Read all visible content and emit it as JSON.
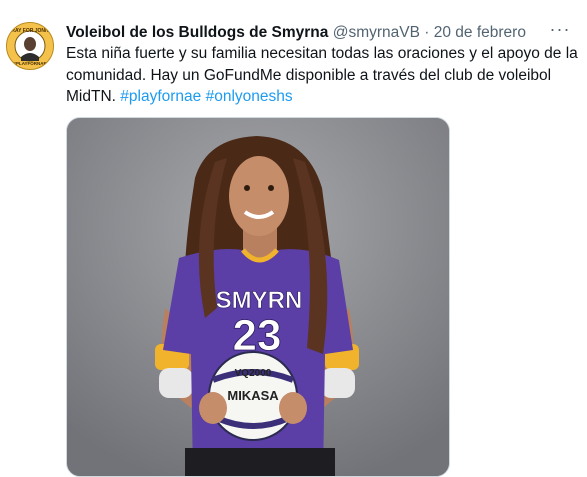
{
  "tweet": {
    "author_name": "Voleibol de los Bulldogs de Smyrna",
    "handle": "@smyrnaVB",
    "separator": "·",
    "date": "20 de febrero",
    "more_label": "···",
    "text": "Esta niña fuerte y su familia necesitan todas las oraciones y el apoyo de la comunidad. Hay un GoFundMe disponible a través del club de voleibol MidTN.",
    "hashtags": [
      "#playfornae",
      "#onlyoneshs"
    ],
    "avatar_text": [
      "PRAY FOR JONNY",
      "#PLAYFORNAE"
    ]
  },
  "photo": {
    "jersey_text": "SMYRN",
    "jersey_number": "23",
    "ball_text": [
      "VQ2000",
      "MIKASA"
    ]
  },
  "colors": {
    "hashtag": "#1d9bf0",
    "secondary_text": "#536471",
    "jersey": "#5b3ea6",
    "jersey_trim": "#f2b32c"
  },
  "icons": {
    "more": "more-horizontal-icon"
  }
}
